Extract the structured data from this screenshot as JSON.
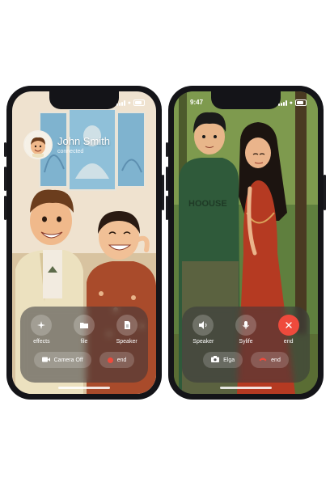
{
  "left_phone": {
    "caller": {
      "name": "John Smith",
      "status": "connected"
    },
    "controls": [
      {
        "label": "effects",
        "icon": "sparkle-icon"
      },
      {
        "label": "file",
        "icon": "folder-icon"
      },
      {
        "label": "Speaker",
        "icon": "document-icon"
      }
    ],
    "pills": {
      "camera": "Camera Off",
      "end": "end"
    }
  },
  "right_phone": {
    "time": "9:47",
    "controls": [
      {
        "label": "Speaker",
        "icon": "speaker-icon"
      },
      {
        "label": "Sylife",
        "icon": "microphone-icon"
      },
      {
        "label": "end",
        "icon": "close-icon"
      }
    ],
    "pills": {
      "camera": "Elga",
      "end": "end"
    },
    "hoodie_text": "HOOUSE"
  },
  "colors": {
    "end_red": "#ef4a3c",
    "phone_frame": "#141418"
  }
}
